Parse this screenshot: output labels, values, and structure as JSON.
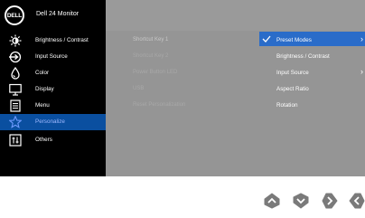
{
  "header": {
    "logo": "DELL",
    "title": "Dell 24 Monitor"
  },
  "main_menu": [
    {
      "label": "Brightness / Contrast",
      "icon": "brightness-icon"
    },
    {
      "label": "Input Source",
      "icon": "input-source-icon"
    },
    {
      "label": "Color",
      "icon": "color-icon"
    },
    {
      "label": "Display",
      "icon": "display-icon"
    },
    {
      "label": "Menu",
      "icon": "menu-icon"
    },
    {
      "label": "Personalize",
      "icon": "star-icon",
      "active": true
    },
    {
      "label": "Others",
      "icon": "others-icon"
    }
  ],
  "submenu": [
    {
      "label": "Shortcut Key 1",
      "highlight": true
    },
    {
      "label": "Shortcut Key 2"
    },
    {
      "label": "Power Button LED"
    },
    {
      "label": "USB"
    },
    {
      "label": "Reset Personalization"
    }
  ],
  "options": [
    {
      "label": "Preset Modes",
      "checked": true,
      "has_arrow": true
    },
    {
      "label": "Brightness / Contrast"
    },
    {
      "label": "Input Source",
      "has_arrow": true
    },
    {
      "label": "Aspect Ratio"
    },
    {
      "label": "Rotation"
    }
  ],
  "controls": [
    {
      "name": "up-button",
      "icon": "chevron-up-icon"
    },
    {
      "name": "down-button",
      "icon": "chevron-down-icon"
    },
    {
      "name": "right-button",
      "icon": "chevron-right-icon"
    },
    {
      "name": "back-button",
      "icon": "chevron-left-icon"
    }
  ],
  "colors": {
    "panel_bg": "#959595",
    "left_bg": "#000000",
    "active_item_bg": "#0a4fa0",
    "active_item_text": "#9fb8ff",
    "selected_option_bg": "#2a6cc9",
    "control_fill": "#7a7a7a"
  }
}
